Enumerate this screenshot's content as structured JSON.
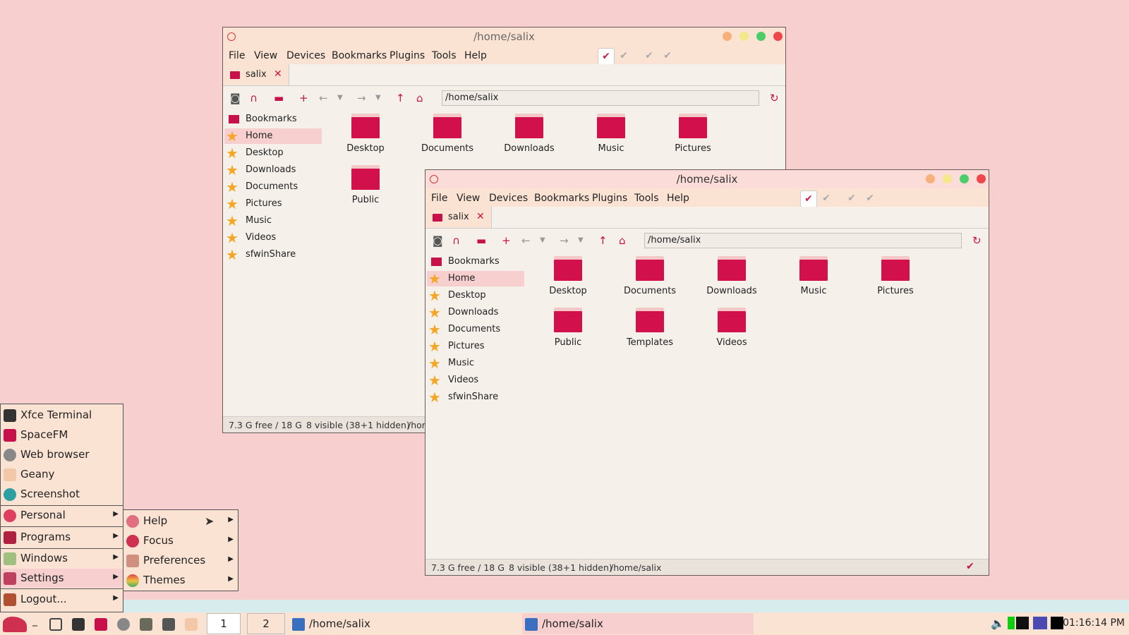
{
  "window1": {
    "title": "/home/salix",
    "menu": [
      "File",
      "View",
      "Devices",
      "Bookmarks",
      "Plugins",
      "Tools",
      "Help"
    ],
    "tab_label": "salix",
    "path": "/home/salix",
    "sidebar": {
      "header": "Bookmarks",
      "items": [
        "Home",
        "Desktop",
        "Downloads",
        "Documents",
        "Pictures",
        "Music",
        "Videos",
        "sfwinShare"
      ]
    },
    "files": [
      "Desktop",
      "Documents",
      "Downloads",
      "Music",
      "Pictures",
      "Public"
    ],
    "status": {
      "free": "7.3 G free / 18 G",
      "visible": "8 visible (38+1 hidden)",
      "path": "/hom"
    }
  },
  "window2": {
    "title": "/home/salix",
    "menu": [
      "File",
      "View",
      "Devices",
      "Bookmarks",
      "Plugins",
      "Tools",
      "Help"
    ],
    "tab_label": "salix",
    "path": "/home/salix",
    "sidebar": {
      "header": "Bookmarks",
      "items": [
        "Home",
        "Desktop",
        "Downloads",
        "Documents",
        "Pictures",
        "Music",
        "Videos",
        "sfwinShare"
      ]
    },
    "files": [
      "Desktop",
      "Documents",
      "Downloads",
      "Music",
      "Pictures",
      "Public",
      "Templates",
      "Videos"
    ],
    "status": {
      "free": "7.3 G free / 18 G",
      "visible": "8 visible (38+1 hidden)",
      "path": "/home/salix"
    }
  },
  "app_menu": {
    "apps": [
      "Xfce Terminal",
      "SpaceFM",
      "Web browser",
      "Geany",
      "Screenshot"
    ],
    "categories": [
      "Personal",
      "Programs",
      "Windows",
      "Settings"
    ],
    "logout": "Logout..."
  },
  "submenu": {
    "items": [
      "Help",
      "Focus",
      "Preferences",
      "Themes"
    ]
  },
  "taskbar": {
    "workspaces": [
      "1",
      "2"
    ],
    "tasks": [
      "/home/salix",
      "/home/salix"
    ],
    "clock": "01:16:14 PM"
  },
  "colors": {
    "accent": "#c8104a",
    "background": "#f6cfce",
    "panel": "#fbe3d4"
  }
}
